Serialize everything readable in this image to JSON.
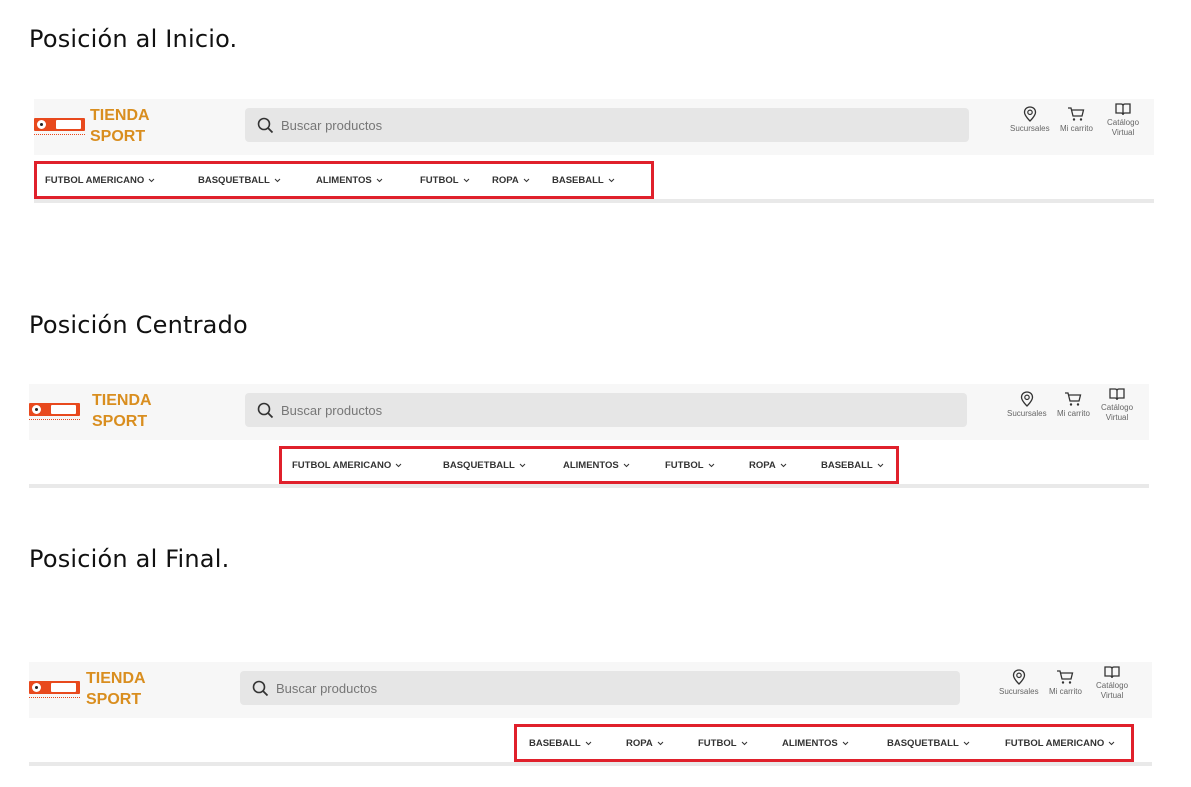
{
  "sections": [
    {
      "heading": "Posición al Inicio.",
      "menu_items": [
        "FUTBOL AMERICANO",
        "BASQUETBALL",
        "ALIMENTOS",
        "FUTBOL",
        "ROPA",
        "BASEBALL"
      ]
    },
    {
      "heading": "Posición Centrado",
      "menu_items": [
        "FUTBOL AMERICANO",
        "BASQUETBALL",
        "ALIMENTOS",
        "FUTBOL",
        "ROPA",
        "BASEBALL"
      ]
    },
    {
      "heading": "Posición al Final.",
      "menu_items": [
        "BASEBALL",
        "ROPA",
        "FUTBOL",
        "ALIMENTOS",
        "BASQUETBALL",
        "FUTBOL AMERICANO"
      ]
    }
  ],
  "header": {
    "brand_line1": "TIENDA",
    "brand_line2": "SPORT",
    "search_placeholder": "Buscar productos",
    "stores_label": "Sucursales",
    "cart_label": "Mi carrito",
    "catalog_line1": "Catálogo",
    "catalog_line2": "Virtual"
  },
  "colors": {
    "brand": "#d98e1f",
    "highlight_border": "#e0202b",
    "logo": "#e8491d"
  },
  "icons": {
    "search": "search-icon",
    "stores": "location-pin-icon",
    "cart": "cart-icon",
    "catalog": "open-book-icon",
    "dropdown": "chevron-down-icon"
  }
}
